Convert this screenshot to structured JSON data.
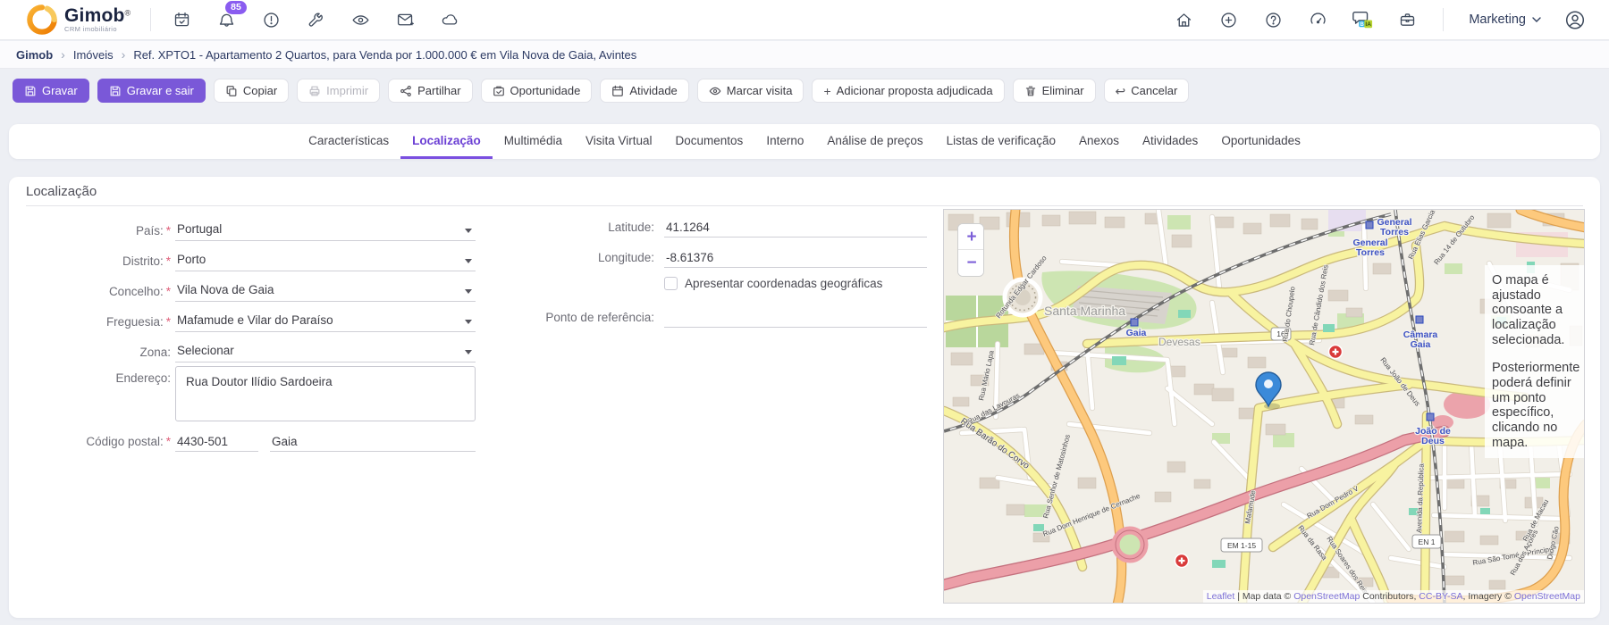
{
  "header": {
    "brand": {
      "name": "Gimob",
      "registered": "®",
      "tagline": "CRM imobiliário"
    },
    "notifications_badge": "85",
    "bia": {
      "b": "B",
      "ia": "IA"
    },
    "user_menu_label": "Marketing"
  },
  "breadcrumb": {
    "items": [
      "Gimob",
      "Imóveis",
      "Ref. XPTO1 - Apartamento 2 Quartos, para Venda por 1.000.000 € em Vila Nova de Gaia, Avintes"
    ]
  },
  "toolbar": {
    "gravar": "Gravar",
    "gravar_e_sair": "Gravar e sair",
    "copiar": "Copiar",
    "imprimir": "Imprimir",
    "partilhar": "Partilhar",
    "oportunidade": "Oportunidade",
    "atividade": "Atividade",
    "marcar_visita": "Marcar visita",
    "adicionar_plus": "+",
    "adicionar_proposta": "Adicionar proposta adjudicada",
    "eliminar": "Eliminar",
    "cancelar_arrow": "↩",
    "cancelar": "Cancelar"
  },
  "tabs": [
    "Características",
    "Localização",
    "Multimédia",
    "Visita Virtual",
    "Documentos",
    "Interno",
    "Análise de preços",
    "Listas de verificação",
    "Anexos",
    "Atividades",
    "Oportunidades"
  ],
  "form": {
    "section_title": "Localização",
    "required_marker": "*",
    "pais": {
      "label": "País:",
      "value": "Portugal"
    },
    "distrito": {
      "label": "Distrito:",
      "value": "Porto"
    },
    "concelho": {
      "label": "Concelho:",
      "value": "Vila Nova de Gaia"
    },
    "freguesia": {
      "label": "Freguesia:",
      "value": "Mafamude e Vilar do Paraíso"
    },
    "zona": {
      "label": "Zona:",
      "value": "Selecionar"
    },
    "endereco": {
      "label": "Endereço:",
      "value": "Rua Doutor Ilídio Sardoeira"
    },
    "codigo_postal": {
      "label": "Código postal:",
      "value": "4430-501",
      "locality": "Gaia"
    },
    "latitude": {
      "label": "Latitude:",
      "value": "41.1264"
    },
    "longitude": {
      "label": "Longitude:",
      "value": "-8.61376"
    },
    "coords_checkbox_label": "Apresentar coordenadas geográficas",
    "ponto_referencia": {
      "label": "Ponto de referência:",
      "value": ""
    }
  },
  "map": {
    "zoom_in": "+",
    "zoom_out": "−",
    "overlay": {
      "p1": "O mapa é ajustado consoante a localização selecionada.",
      "p2": "Posteriormente poderá definir um ponto específico, clicando no mapa."
    },
    "attribution": {
      "leaflet": "Leaflet",
      "map_data": " | Map data © ",
      "osm1": "OpenStreetMap",
      "contributors": " Contributors, ",
      "license": "CC-BY-SA",
      "imagery": ", Imagery © ",
      "osm2": "OpenStreetMap"
    },
    "places": [
      "Santa Marinha",
      "Devesas"
    ],
    "stations": [
      "General Torres",
      "General Torres",
      "Câmara Gaia",
      "João de Deus",
      "Gaia"
    ],
    "station_lines": [
      [
        "General",
        "Torres"
      ],
      [
        "General",
        "Torres"
      ],
      [
        "Câmara",
        "Gaia"
      ],
      [
        "João de",
        "Deus"
      ],
      [
        "Gaia"
      ]
    ],
    "shields": [
      "16",
      "EM 1-15",
      "EN 1"
    ],
    "streets": [
      "Rotunda Edgar Cardoso",
      "Rua Mário Lapa",
      "Rua das Lavouras",
      "Rua Barão do Corvo",
      "Rua Senhor de Matosinhos",
      "Rua Dom Henrique de Cernache",
      "Rua do Choupelo",
      "Rua de Cândido dos Reis",
      "Rua João de Deus",
      "Rua Dom Pedro V",
      "Avenida da República",
      "Rua da Rasa",
      "Rua Soares dos Reis",
      "Rua São Tomé e Príncipe",
      "Rua de Macau",
      "Rua dos Açores",
      "Rua Elias Garcia",
      "Rua 14 de Outubro",
      "Mafamude",
      "Diogo Cão"
    ]
  }
}
